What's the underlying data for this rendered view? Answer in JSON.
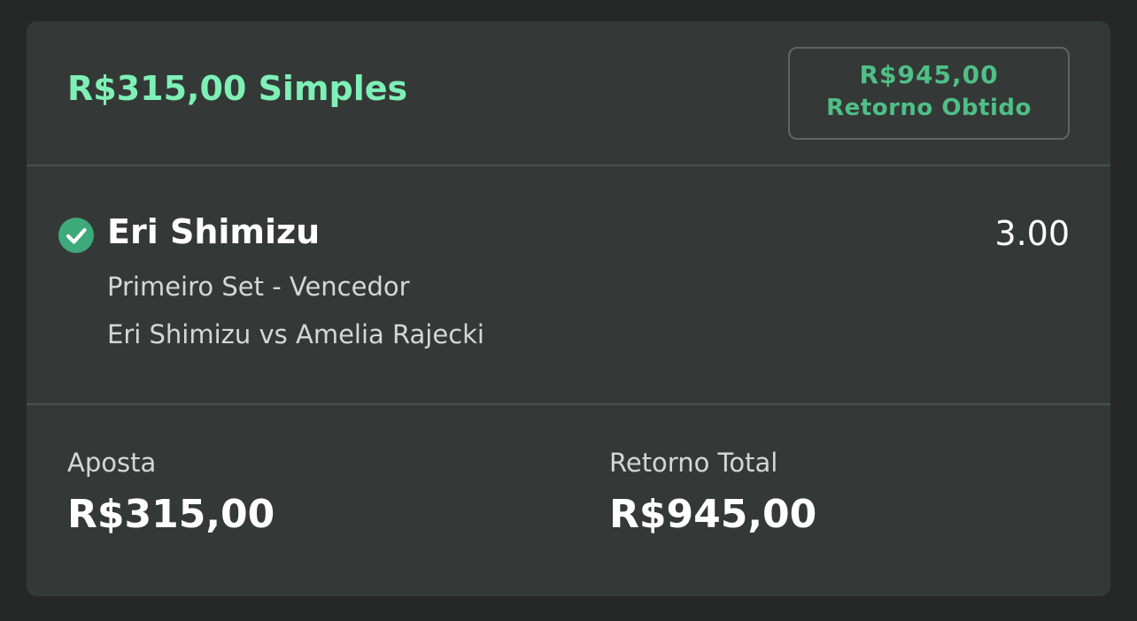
{
  "header": {
    "stake_type": "R$315,00 Simples",
    "return_badge": {
      "amount": "R$945,00",
      "label": "Retorno Obtido"
    }
  },
  "selection": {
    "status_icon": "check-circle-icon",
    "player": "Eri Shimizu",
    "odds": "3.00",
    "market": "Primeiro Set - Vencedor",
    "event": "Eri Shimizu vs Amelia Rajecki"
  },
  "footer": {
    "stake_label": "Aposta",
    "stake_value": "R$315,00",
    "total_return_label": "Retorno Total",
    "total_return_value": "R$945,00"
  },
  "colors": {
    "accent_green": "#7ef0b6",
    "badge_green": "#4fbf86",
    "check_green": "#3ea97a",
    "card_bg": "#343937",
    "page_bg": "#262727"
  }
}
